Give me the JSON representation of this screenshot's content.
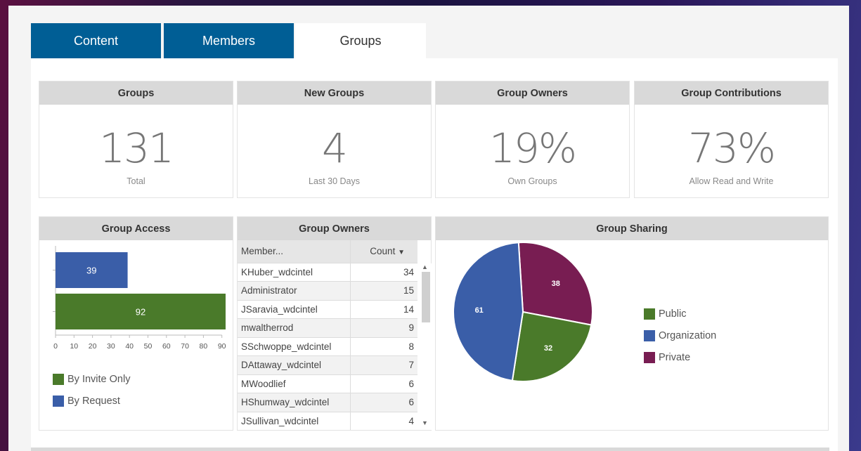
{
  "tabs": [
    {
      "label": "Content"
    },
    {
      "label": "Members"
    },
    {
      "label": "Groups"
    }
  ],
  "stats": [
    {
      "title": "Groups",
      "value": "131",
      "label": "Total"
    },
    {
      "title": "New Groups",
      "value": "4",
      "label": "Last 30 Days"
    },
    {
      "title": "Group Owners",
      "value": "19%",
      "label": "Own Groups"
    },
    {
      "title": "Group Contributions",
      "value": "73%",
      "label": "Allow Read and Write"
    }
  ],
  "access": {
    "title": "Group Access"
  },
  "owners": {
    "title": "Group Owners",
    "col_member": "Member...",
    "col_count": "Count",
    "sort_icon": "sort-down-icon",
    "rows": [
      {
        "member": "KHuber_wdcintel",
        "count": "34"
      },
      {
        "member": "Administrator",
        "count": "15"
      },
      {
        "member": "JSaravia_wdcintel",
        "count": "14"
      },
      {
        "member": "mwaltherrod",
        "count": "9"
      },
      {
        "member": "SSchwoppe_wdcintel",
        "count": "8"
      },
      {
        "member": "DAttaway_wdcintel",
        "count": "7"
      },
      {
        "member": "MWoodlief",
        "count": "6"
      },
      {
        "member": "HShumway_wdcintel",
        "count": "6"
      },
      {
        "member": "JSullivan_wdcintel",
        "count": "4"
      }
    ]
  },
  "sharing": {
    "title": "Group Sharing"
  },
  "colors": {
    "green": "#4a7a2a",
    "blue": "#3a5ea8",
    "maroon": "#781d52",
    "tab_blue": "#005e95"
  },
  "chart_data": [
    {
      "type": "bar",
      "orientation": "horizontal",
      "categories": [
        "By Request",
        "By Invite Only"
      ],
      "values": [
        39,
        92
      ],
      "colors": [
        "#3a5ea8",
        "#4a7a2a"
      ],
      "xlim": [
        0,
        90
      ],
      "xticks": [
        0,
        10,
        20,
        30,
        40,
        50,
        60,
        70,
        80,
        90
      ],
      "legend": [
        {
          "label": "By Invite Only",
          "color": "#4a7a2a"
        },
        {
          "label": "By Request",
          "color": "#3a5ea8"
        }
      ],
      "legend_position": "bottom-left"
    },
    {
      "type": "pie",
      "slices": [
        {
          "label": "Private",
          "value": 38,
          "color": "#781d52"
        },
        {
          "label": "Public",
          "value": 32,
          "color": "#4a7a2a"
        },
        {
          "label": "Organization",
          "value": 61,
          "color": "#3a5ea8"
        }
      ],
      "legend": [
        {
          "label": "Public",
          "color": "#4a7a2a"
        },
        {
          "label": "Organization",
          "color": "#3a5ea8"
        },
        {
          "label": "Private",
          "color": "#781d52"
        }
      ],
      "legend_position": "right"
    }
  ]
}
